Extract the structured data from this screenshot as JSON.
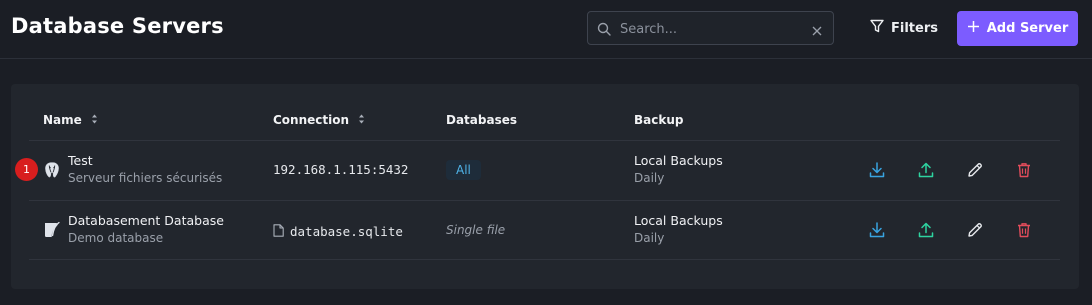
{
  "header": {
    "title": "Database Servers",
    "search_placeholder": "Search...",
    "filters_label": "Filters",
    "add_label": "Add Server"
  },
  "table": {
    "columns": {
      "name": "Name",
      "connection": "Connection",
      "databases": "Databases",
      "backup": "Backup"
    },
    "rows": [
      {
        "name": "Test",
        "description": "Serveur fichiers sécurisés",
        "connection": "192.168.1.115:5432",
        "databases": "All",
        "backup": "Local Backups",
        "schedule": "Daily",
        "marker": "1",
        "icon": "postgresql-icon"
      },
      {
        "name": "Databasement Database",
        "description": "Demo database",
        "connection": "database.sqlite",
        "databases": "Single file",
        "backup": "Local Backups",
        "schedule": "Daily",
        "icon": "sqlite-icon"
      }
    ]
  },
  "colors": {
    "accent": "#7c5cff",
    "background": "#1b1e25",
    "panel": "#22262d",
    "download": "#38a3e0",
    "upload": "#2ed3a0",
    "edit": "#e6e8ec",
    "delete": "#e24c5b",
    "badge_text": "#4fb3e8",
    "marker": "#d81e1e"
  }
}
